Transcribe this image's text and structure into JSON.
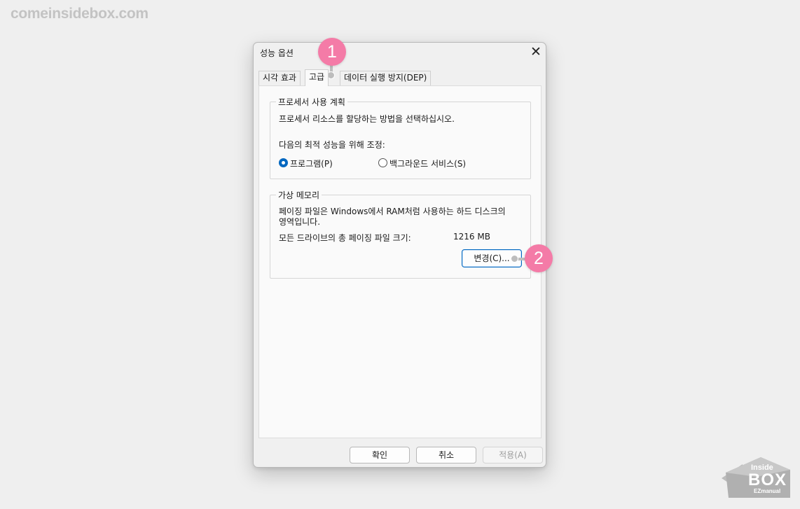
{
  "watermark": "comeinsidebox.com",
  "dialog": {
    "title": "성능 옵션",
    "close_glyph": "✕",
    "tabs": [
      "시각 효과",
      "고급",
      "데이터 실행 방지(DEP)"
    ],
    "processor": {
      "group_title": "프로세서 사용 계획",
      "description": "프로세서 리소스를 할당하는 방법을 선택하십시오.",
      "adjust_label": "다음의 최적 성능을 위해 조정:",
      "option_programs": "프로그램(P)",
      "option_background": "백그라운드 서비스(S)",
      "selected": "프로그램(P)"
    },
    "virtual_memory": {
      "group_title": "가상 메모리",
      "description_line1": "페이징 파일은 Windows에서 RAM처럼 사용하는 하드 디스크의",
      "description_line2": "영역입니다.",
      "total_label": "모든 드라이브의 총 페이징 파일 크기:",
      "total_value": "1216 MB",
      "change_button": "변경(C)..."
    },
    "footer": {
      "ok": "확인",
      "cancel": "취소",
      "apply": "적용(A)"
    }
  },
  "annotations": {
    "badge1": "1",
    "badge2": "2",
    "badge_color": "#f47ba7"
  },
  "logo": {
    "line1": "Inside",
    "line2": "BOX",
    "line3": "EZmanual"
  },
  "colors": {
    "accent": "#0067c0",
    "background": "#efefef",
    "dialog": "#f0f0f0"
  }
}
